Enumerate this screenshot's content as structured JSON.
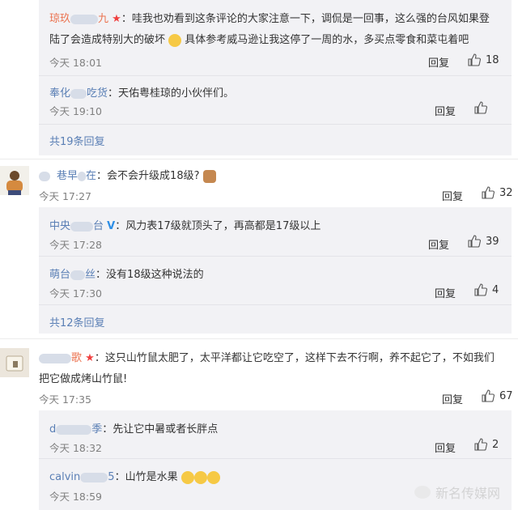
{
  "thread1": {
    "replies": [
      {
        "user": "琼玖",
        "text_line1": "哇我也劝看到这条评论的大家注意一下，调侃是一回事，这么强的台风如果登",
        "text_line2a": "陆了会造成特别大的破坏",
        "text_line2b": "具体参考威马逊让我这停了一周的水，多买点零食和菜屯着吧",
        "time": "今天 18:01",
        "reply": "回复",
        "likes": "18"
      },
      {
        "user": "奉化",
        "user_tail": "吃货",
        "text": "天佑粤桂琼的小伙伴们。",
        "time": "今天 19:10",
        "reply": "回复",
        "likes": ""
      }
    ],
    "more": "共19条回复"
  },
  "thread2": {
    "user": "巷早",
    "user_tail": "在",
    "text": "会不会升级成18级?",
    "time": "今天 17:27",
    "reply": "回复",
    "likes": "32",
    "replies": [
      {
        "user": "中央",
        "user_tail": "台",
        "text": "风力表17级就顶头了，再高都是17级以上",
        "time": "今天 17:28",
        "reply": "回复",
        "likes": "39"
      },
      {
        "user": "萌台",
        "user_tail": "丝",
        "text": "没有18级这种说法的",
        "time": "今天 17:30",
        "reply": "回复",
        "likes": "4"
      }
    ],
    "more": "共12条回复"
  },
  "thread3": {
    "user": "歌",
    "text_line1": "这只山竹鼠太肥了，太平洋都让它吃空了，这样下去不行啊，养不起它了，不如我们",
    "text_line2": "把它做成烤山竹鼠!",
    "time": "今天 17:35",
    "reply": "回复",
    "likes": "67",
    "replies": [
      {
        "user": "d",
        "user_tail": "季",
        "text": "先让它中暑或者长胖点",
        "time": "今天 18:32",
        "reply": "回复",
        "likes": "2"
      },
      {
        "user": "calvin",
        "user_tail": "5",
        "text": "山竹是水果",
        "time": "今天 18:59",
        "reply": "回复",
        "likes": ""
      }
    ]
  },
  "watermark": "新名传媒网",
  "colors": {
    "name": "#eb7350",
    "link": "#5a7fb5",
    "reply_bg": "#f2f2f5"
  }
}
